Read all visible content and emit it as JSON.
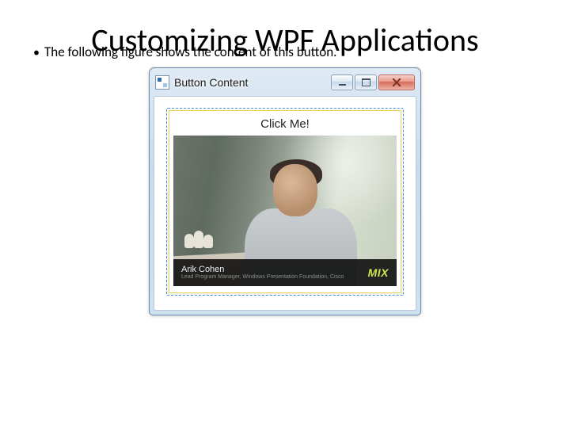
{
  "slide": {
    "title": "Customizing WPF Applications",
    "bullet": "The following figure shows the content of this button."
  },
  "window": {
    "title": "Button Content",
    "controls": {
      "min": "minimize",
      "max": "maximize",
      "close": "close"
    }
  },
  "button": {
    "label": "Click Me!"
  },
  "imageCaption": {
    "name": "Arik Cohen",
    "subtitle": "Lead Program Manager, Windows Presentation Foundation, Cisco",
    "logo": "MIX"
  }
}
